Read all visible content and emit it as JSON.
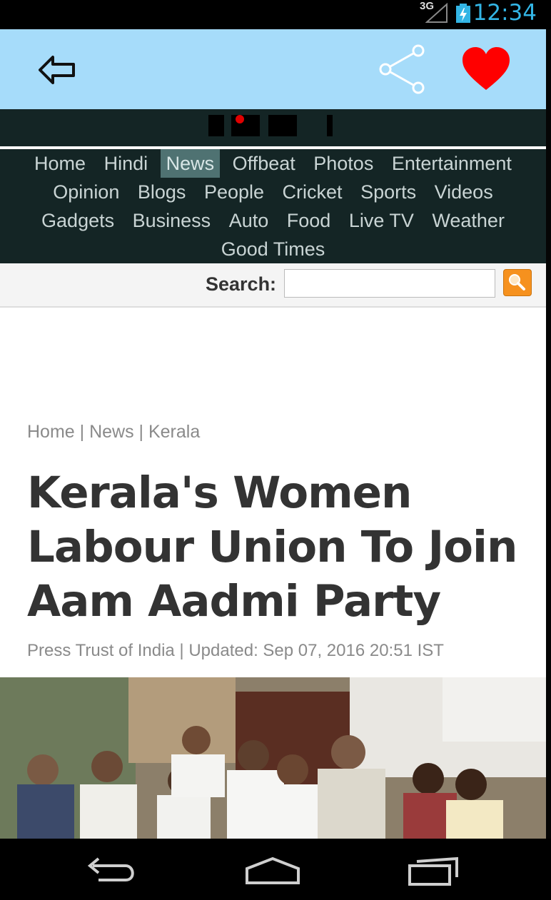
{
  "status_bar": {
    "network": "3G",
    "time": "12:34"
  },
  "app_bar": {
    "back_icon": "back-arrow-icon",
    "share_icon": "share-icon",
    "favorite_icon": "heart-icon",
    "favorite_color": "#ff0000",
    "background": "#a6dcfa"
  },
  "site_nav": {
    "rows": [
      [
        "Home",
        "Hindi",
        "News",
        "Offbeat",
        "Photos",
        "Entertainment"
      ],
      [
        "Opinion",
        "Blogs",
        "People",
        "Cricket",
        "Sports",
        "Videos"
      ],
      [
        "Gadgets",
        "Business",
        "Auto",
        "Food",
        "Live TV",
        "Weather"
      ],
      [
        "Good Times"
      ]
    ],
    "active": "News"
  },
  "search": {
    "label": "Search:",
    "value": "",
    "button_icon": "magnifier-icon"
  },
  "breadcrumb": "Home | News | Kerala",
  "headline": "Kerala's Women Labour Union To Join Aam Aadmi Party",
  "byline": "Press Trust of India | Updated: Sep 07, 2016 20:51 IST",
  "system_nav": {
    "back_icon": "nav-back-icon",
    "home_icon": "nav-home-icon",
    "recents_icon": "nav-recents-icon"
  }
}
